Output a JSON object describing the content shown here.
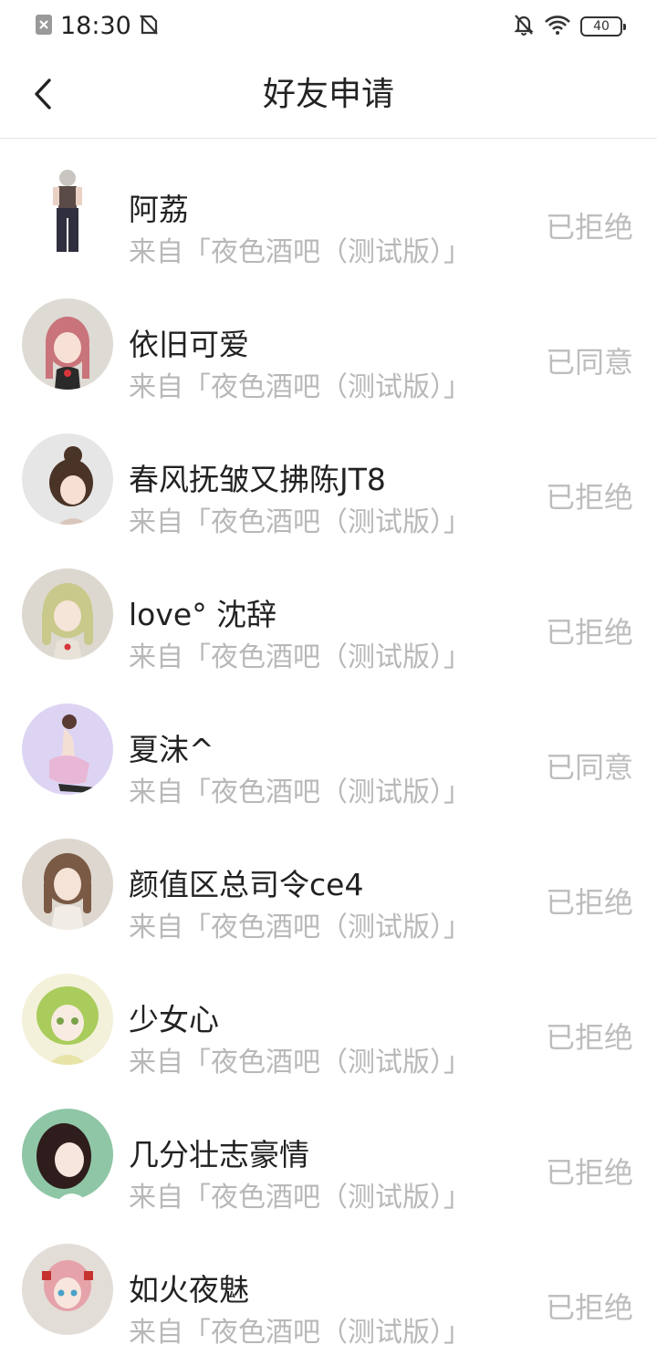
{
  "status_bar": {
    "time": "18:30",
    "battery": "40",
    "icons": [
      "close-notification-icon",
      "no-sim-icon",
      "mute-bell-icon",
      "wifi-icon",
      "battery-icon"
    ]
  },
  "nav": {
    "title": "好友申请",
    "back_icon": "chevron-left-icon"
  },
  "requests": [
    {
      "name": "阿荔",
      "source": "来自「夜色酒吧（测试版）」",
      "status": "已拒绝"
    },
    {
      "name": "依旧可爱",
      "source": "来自「夜色酒吧（测试版）」",
      "status": "已同意"
    },
    {
      "name": "春风抚皱又拂陈JT8",
      "source": "来自「夜色酒吧（测试版）」",
      "status": "已拒绝"
    },
    {
      "name": "love° 沈辞",
      "source": "来自「夜色酒吧（测试版）」",
      "status": "已拒绝"
    },
    {
      "name": "夏沫^",
      "source": "来自「夜色酒吧（测试版）」",
      "status": "已同意"
    },
    {
      "name": "颜值区总司令ce4",
      "source": "来自「夜色酒吧（测试版）」",
      "status": "已拒绝"
    },
    {
      "name": "少女心",
      "source": "来自「夜色酒吧（测试版）」",
      "status": "已拒绝"
    },
    {
      "name": "几分壮志豪情",
      "source": "来自「夜色酒吧（测试版）」",
      "status": "已拒绝"
    },
    {
      "name": "如火夜魅",
      "source": "来自「夜色酒吧（测试版）」",
      "status": "已拒绝"
    }
  ],
  "colors": {
    "name_text": "#222222",
    "secondary_text": "#b8b8b8",
    "status_text": "#bdbdbd",
    "divider": "#e6e6e6"
  }
}
